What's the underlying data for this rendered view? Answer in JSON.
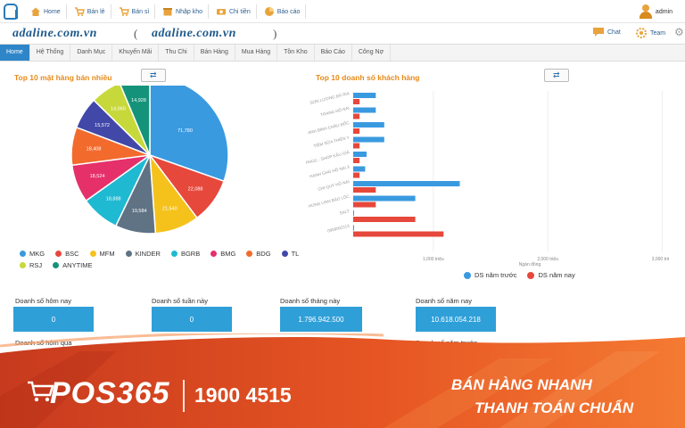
{
  "topnav": {
    "items": [
      {
        "label": "Home",
        "icon": "home-icon",
        "color": "#e8a33c"
      },
      {
        "label": "Bán lẻ",
        "icon": "cart-icon",
        "color": "#e8a33c"
      },
      {
        "label": "Bán sỉ",
        "icon": "cart-icon",
        "color": "#e8a33c"
      },
      {
        "label": "Nhập kho",
        "icon": "box-icon",
        "color": "#e8a33c"
      },
      {
        "label": "Chi tiền",
        "icon": "money-icon",
        "color": "#e8a33c"
      },
      {
        "label": "Báo cáo",
        "icon": "report-icon",
        "color": "#e8a33c"
      }
    ],
    "user": "admin"
  },
  "domain": {
    "primary": "adaline.com.vn",
    "secondary": "adaline.com.vn",
    "chat_label": "Chat",
    "team_label": "Team"
  },
  "menu": {
    "items": [
      "Home",
      "Hệ Thống",
      "Danh Mục",
      "Khuyến Mãi",
      "Thu Chi",
      "Bán Hàng",
      "Mua Hàng",
      "Tồn Kho",
      "Báo Cáo",
      "Công Nợ"
    ],
    "active": "Home"
  },
  "pie_panel": {
    "title": "Top 10 mặt hàng bán nhiều"
  },
  "bar_panel": {
    "title": "Top 10 doanh số  khách hàng"
  },
  "chart_data": [
    {
      "type": "pie",
      "title": "Top 10 mặt hàng bán nhiều",
      "slices": [
        {
          "label": "MKG",
          "value": 71780,
          "display": "71,780",
          "color": "#3a9ae0"
        },
        {
          "label": "BSC",
          "value": 22088,
          "display": "22,088",
          "color": "#e6483b"
        },
        {
          "label": "MFM",
          "value": 21540,
          "display": "21,540",
          "color": "#f5c21c"
        },
        {
          "label": "KINDER",
          "value": 19584,
          "display": "19,584",
          "color": "#5f7385"
        },
        {
          "label": "BGRB",
          "value": 18888,
          "display": "18,888",
          "color": "#1fb9d2"
        },
        {
          "label": "BMG",
          "value": 18524,
          "display": "18,524",
          "color": "#e5306a"
        },
        {
          "label": "BDG",
          "value": 18408,
          "display": "18,408",
          "color": "#f26b2d"
        },
        {
          "label": "TL",
          "value": 15572,
          "display": "15,572",
          "color": "#4248a8"
        },
        {
          "label": "RSJ",
          "value": 14960,
          "display": "14,960",
          "color": "#c7d93a"
        },
        {
          "label": "ANYTIME",
          "value": 14928,
          "display": "14,928",
          "color": "#15937a"
        }
      ],
      "legend_placement": "bottom"
    },
    {
      "type": "bar",
      "orientation": "horizontal",
      "title": "Top 10 doanh số  khách hàng",
      "categories": [
        "SƠN LƯƠNG ĐÀ RIA",
        "TRANG HỒ NAI",
        "ANH BÌNH CHÂU ĐỐC",
        "TIỆM SỮA THIÊN Y",
        "PHÚC - SHOP KÂU GIẢ",
        "HẠNH GHG HỒ NAI 3",
        "CHỊ QUÝ HỒ NAI",
        "HÙNG LINH BẢO LỘC",
        "SALT",
        "0908002113"
      ],
      "series": [
        {
          "name": "DS năm trước",
          "color": "#3a9ae0",
          "values": [
            320,
            320,
            440,
            440,
            190,
            170,
            1510,
            880,
            0,
            5
          ]
        },
        {
          "name": "DS năm nay",
          "color": "#e6483b",
          "values": [
            90,
            90,
            90,
            90,
            90,
            90,
            320,
            320,
            880,
            1280
          ]
        }
      ],
      "xticks": [
        "1,000 triệu",
        "2,000 triệu",
        "3,000 triệu"
      ],
      "xunit": "Ngàn đồng",
      "xlim": [
        0,
        3000
      ],
      "legend_placement": "bottom"
    }
  ],
  "stats": [
    {
      "label": "Doanh số hôm nay",
      "value": "0"
    },
    {
      "label": "Doanh số tuần này",
      "value": "0"
    },
    {
      "label": "Doanh số tháng này",
      "value": "1.796.942.500"
    },
    {
      "label": "Doanh số năm nay",
      "value": "10.618.054.218"
    }
  ],
  "stats_prev": [
    {
      "label": "Doanh số hôm qua"
    },
    {
      "label": "Doanh số năm trước"
    }
  ],
  "banner": {
    "brand": "POS365",
    "hotline": "1900 4515",
    "slogan_1": "BÁN HÀNG NHANH",
    "slogan_2": "THANH TOÁN CHUẨN",
    "colors": {
      "dark": "#c63a1c",
      "light": "#f16a2a"
    }
  }
}
